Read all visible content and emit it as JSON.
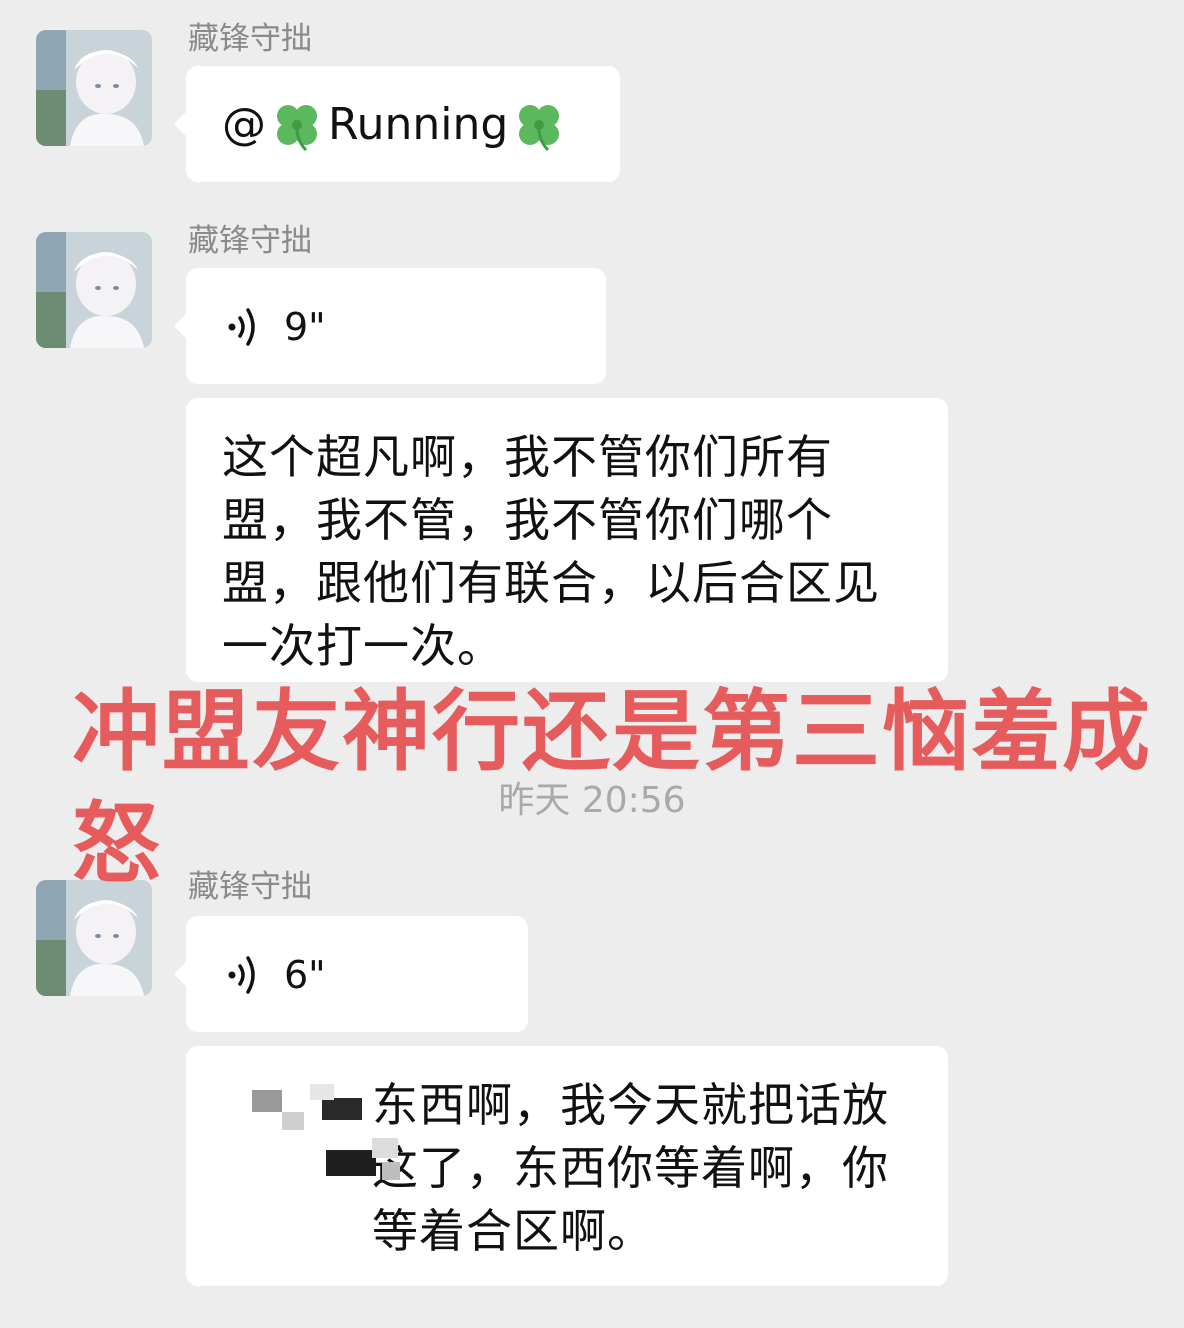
{
  "messages": [
    {
      "sender": "藏锋守拙",
      "type": "text",
      "text_prefix": "@",
      "icon_before": "four-leaf-clover",
      "text_main": "Running",
      "icon_after": "four-leaf-clover"
    },
    {
      "sender": "藏锋守拙",
      "type": "voice",
      "icon": "voice-wave",
      "duration": "9\""
    },
    {
      "sender": "",
      "type": "text",
      "text": "这个超凡啊，我不管你们所有盟，我不管，我不管你们哪个盟，跟他们有联合，以后合区见一次打一次。"
    },
    {
      "sender": "藏锋守拙",
      "type": "voice",
      "icon": "voice-wave",
      "duration": "6\""
    },
    {
      "sender": "",
      "type": "text",
      "text": "东西啊，我今天就把话放这了，东西你等着啊，你等着合区啊。",
      "note_icon": "mosaic-redaction"
    }
  ],
  "timestamp": "昨天 20:56",
  "overlay_caption": "冲盟友神行还是第三恼羞成怒",
  "colors": {
    "background": "#ededed",
    "bubble": "#ffffff",
    "sender_name": "#8a8a8a",
    "timestamp": "#a9a9a9",
    "overlay_caption": "#e44a4a",
    "clover": "#5cb85c"
  }
}
